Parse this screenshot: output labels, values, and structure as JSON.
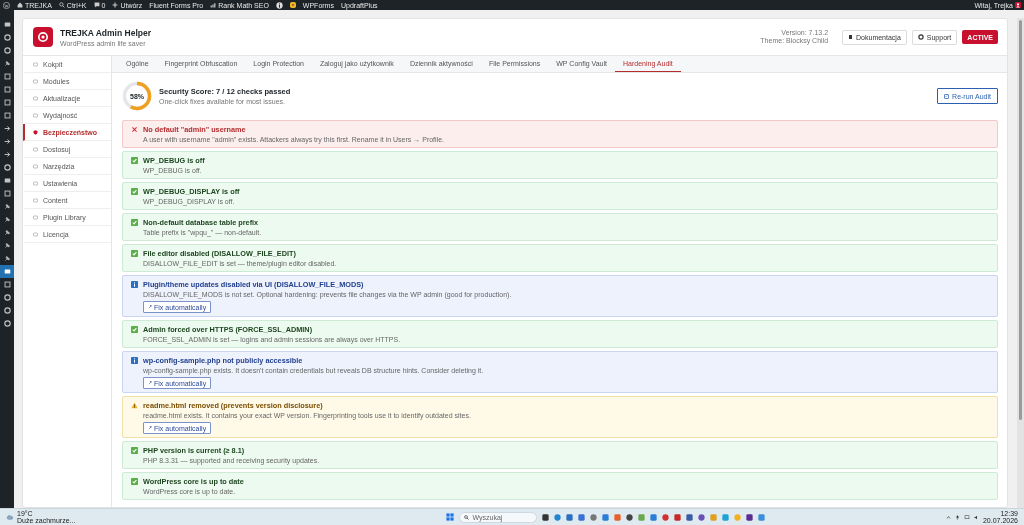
{
  "admin_bar": {
    "items": [
      {
        "kind": "logo"
      },
      {
        "kind": "site",
        "label": "TREJKA"
      },
      {
        "kind": "search",
        "label": "Ctrl+K"
      },
      {
        "kind": "comments",
        "label": "0"
      },
      {
        "kind": "new",
        "label": "Utwórz"
      },
      {
        "kind": "plain",
        "label": "Fluent Forms Pro"
      },
      {
        "kind": "seo",
        "label": "Rank Math SEO"
      },
      {
        "kind": "info"
      },
      {
        "kind": "alert"
      },
      {
        "kind": "plain",
        "label": "WPForms"
      },
      {
        "kind": "plain",
        "label": "UpdraftPlus"
      }
    ],
    "greeting": "Witaj, Trejka"
  },
  "wp_menu": {
    "items": [
      {
        "selected": false
      },
      {
        "selected": false
      },
      {
        "selected": false
      },
      {
        "selected": false
      },
      {
        "selected": false
      },
      {
        "selected": false
      },
      {
        "selected": false
      },
      {
        "selected": false
      },
      {
        "selected": false
      },
      {
        "selected": false
      },
      {
        "selected": false
      },
      {
        "selected": false
      },
      {
        "selected": false
      },
      {
        "selected": false
      },
      {
        "selected": false
      },
      {
        "selected": false
      },
      {
        "selected": false
      },
      {
        "selected": false
      },
      {
        "selected": false
      },
      {
        "selected": true
      },
      {
        "selected": false
      },
      {
        "selected": false
      },
      {
        "selected": false
      },
      {
        "selected": false
      }
    ]
  },
  "plugin": {
    "title": "TREJKA Admin Helper",
    "subtitle": "WordPress admin life saver",
    "version": "Version: 7.13.2",
    "theme": "Theme: Blocksy Child",
    "buttons": [
      {
        "kind": "docs",
        "label": "Dokumentacja"
      },
      {
        "kind": "support",
        "label": "Support"
      }
    ],
    "status": "ACTIVE"
  },
  "sidebar": {
    "items": [
      {
        "label": "Kokpit",
        "selected": false
      },
      {
        "label": "Modules",
        "selected": false
      },
      {
        "label": "Aktualizacje",
        "selected": false
      },
      {
        "label": "Wydajność",
        "selected": false
      },
      {
        "label": "Bezpieczeństwo",
        "selected": true
      },
      {
        "label": "Dostosuj",
        "selected": false
      },
      {
        "label": "Narzędzia",
        "selected": false
      },
      {
        "label": "Ustawienia",
        "selected": false
      },
      {
        "label": "Content",
        "selected": false
      },
      {
        "label": "Plugin Library",
        "selected": false
      },
      {
        "label": "Licencja",
        "selected": false
      }
    ]
  },
  "tabs": [
    {
      "label": "Ogólne",
      "selected": false
    },
    {
      "label": "Fingerprint Obfuscation",
      "selected": false
    },
    {
      "label": "Login Protection",
      "selected": false
    },
    {
      "label": "Zaloguj jako użytkownik",
      "selected": false
    },
    {
      "label": "Dziennik aktywności",
      "selected": false
    },
    {
      "label": "File Permissions",
      "selected": false
    },
    {
      "label": "WP Config Vault",
      "selected": false
    },
    {
      "label": "Hardening Audit",
      "selected": true
    }
  ],
  "score": {
    "percent": "58%",
    "level": 0.58,
    "title": "Security Score: 7 / 12 checks passed",
    "subtitle": "One-click fixes available for most issues."
  },
  "rerun_button": "Re-run Audit",
  "checks": [
    {
      "kind": "fail",
      "title": "No default \"admin\" username",
      "description": "A user with username \"admin\" exists. Attackers always try this first. Rename it in Users → Profile."
    },
    {
      "kind": "pass",
      "title": "WP_DEBUG is off",
      "description": "WP_DEBUG is off."
    },
    {
      "kind": "pass",
      "title": "WP_DEBUG_DISPLAY is off",
      "description": "WP_DEBUG_DISPLAY is off."
    },
    {
      "kind": "pass",
      "title": "Non-default database table prefix",
      "description": "Table prefix is \"wpqu_\" — non-default."
    },
    {
      "kind": "pass",
      "title": "File editor disabled (DISALLOW_FILE_EDIT)",
      "description": "DISALLOW_FILE_EDIT is set — theme/plugin editor disabled."
    },
    {
      "kind": "info",
      "title": "Plugin/theme updates disabled via UI (DISALLOW_FILE_MODS)",
      "description": "DISALLOW_FILE_MODS is not set. Optional hardening: prevents file changes via the WP admin (good for production).",
      "action": "Fix automatically"
    },
    {
      "kind": "pass",
      "title": "Admin forced over HTTPS (FORCE_SSL_ADMIN)",
      "description": "FORCE_SSL_ADMIN is set — logins and admin sessions are always over HTTPS."
    },
    {
      "kind": "info",
      "title": "wp-config-sample.php not publicly accessible",
      "description": "wp-config-sample.php exists. It doesn't contain credentials but reveals DB structure hints. Consider deleting it.",
      "action": "Fix automatically"
    },
    {
      "kind": "warn",
      "title": "readme.html removed (prevents version disclosure)",
      "description": "readme.html exists. It contains your exact WP version. Fingerprinting tools use it to identify outdated sites.",
      "action": "Fix automatically"
    },
    {
      "kind": "pass",
      "title": "PHP version is current (≥ 8.1)",
      "description": "PHP 8.3.31 — supported and receiving security updates."
    },
    {
      "kind": "pass",
      "title": "WordPress core is up to date",
      "description": "WordPress core is up to date."
    }
  ],
  "taskbar": {
    "weather_temp": "19°C",
    "weather_text": "Duże zachmurze...",
    "search_placeholder": "Wyszukaj",
    "time": "12:39",
    "date": "20.07.2026"
  }
}
